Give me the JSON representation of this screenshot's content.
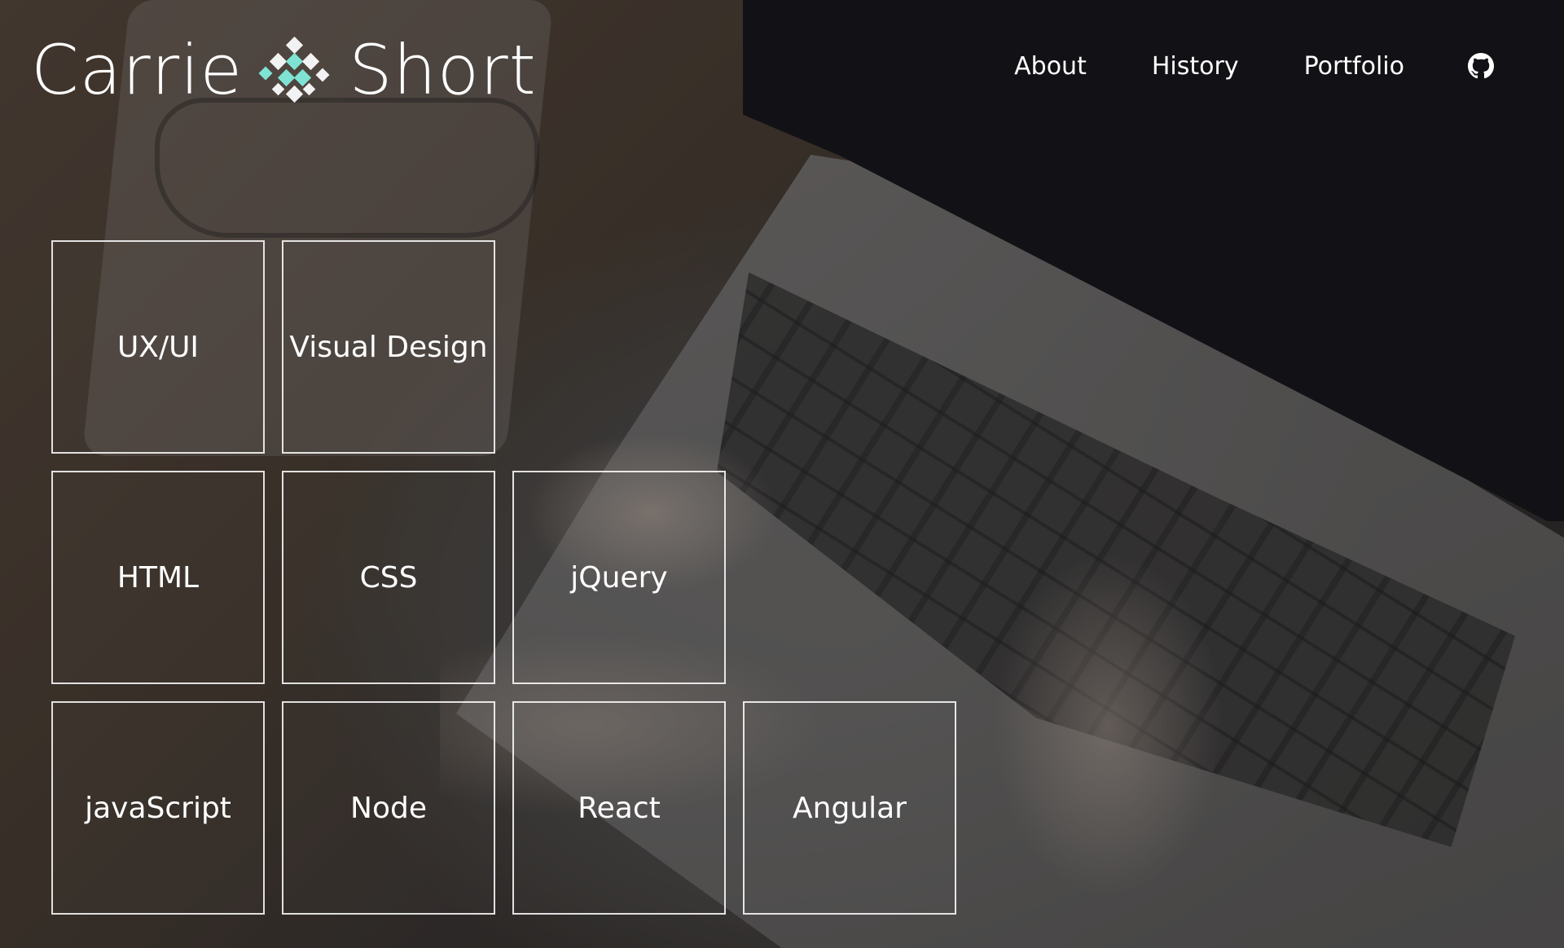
{
  "site": {
    "name_first": "Carrie",
    "name_last": "Short",
    "logo_icon": "diamond-cluster-icon",
    "accent_color": "#7fe3d3"
  },
  "nav": {
    "items": [
      {
        "label": "About"
      },
      {
        "label": "History"
      },
      {
        "label": "Portfolio"
      }
    ],
    "github_icon": "github-icon"
  },
  "skills": {
    "rows": [
      [
        "UX/UI",
        "Visual Design"
      ],
      [
        "HTML",
        "CSS",
        "jQuery"
      ],
      [
        "javaScript",
        "Node",
        "React",
        "Angular"
      ]
    ]
  }
}
